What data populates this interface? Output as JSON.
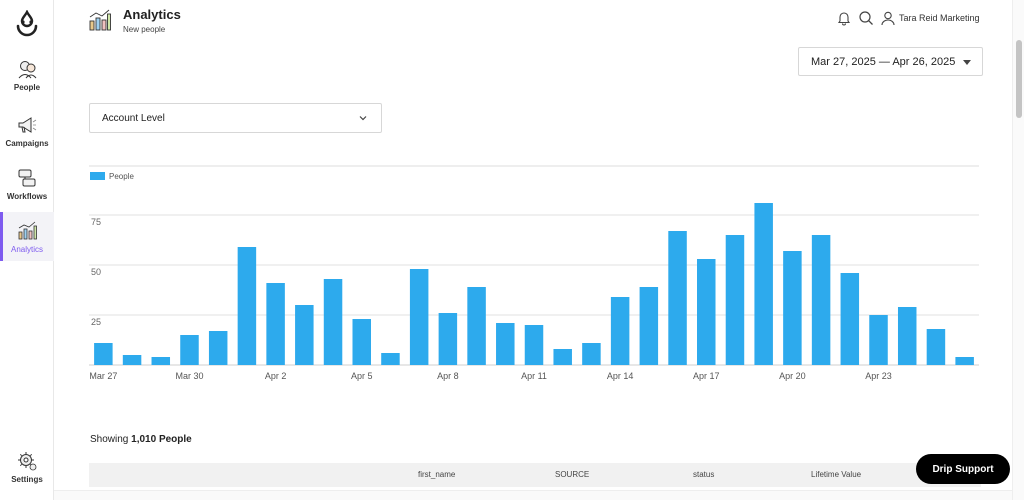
{
  "sidebar": {
    "items": [
      {
        "label": "People",
        "icon": "people-icon"
      },
      {
        "label": "Campaigns",
        "icon": "megaphone-icon"
      },
      {
        "label": "Workflows",
        "icon": "workflow-icon"
      },
      {
        "label": "Analytics",
        "icon": "analytics-icon"
      },
      {
        "label": "Settings",
        "icon": "gear-icon"
      }
    ]
  },
  "header": {
    "title": "Analytics",
    "subtitle": "New people",
    "account": "Tara Reid Marketing"
  },
  "filters": {
    "date_range": "Mar 27, 2025 — Apr 26, 2025",
    "level": "Account Level"
  },
  "colors": {
    "accent": "#7e5bef",
    "bar": "#2daaed",
    "support_bg": "#000000"
  },
  "chart_data": {
    "type": "bar",
    "legend": [
      "People"
    ],
    "categories": [
      "Mar 27",
      "Mar 28",
      "Mar 29",
      "Mar 30",
      "Mar 31",
      "Apr 1",
      "Apr 2",
      "Apr 3",
      "Apr 4",
      "Apr 5",
      "Apr 6",
      "Apr 7",
      "Apr 8",
      "Apr 9",
      "Apr 10",
      "Apr 11",
      "Apr 12",
      "Apr 13",
      "Apr 14",
      "Apr 15",
      "Apr 16",
      "Apr 17",
      "Apr 18",
      "Apr 19",
      "Apr 20",
      "Apr 21",
      "Apr 22",
      "Apr 23",
      "Apr 24",
      "Apr 25",
      "Apr 26"
    ],
    "tick_labels": [
      {
        "index": 0,
        "label": "Mar 27"
      },
      {
        "index": 3,
        "label": "Mar 30"
      },
      {
        "index": 6,
        "label": "Apr 2"
      },
      {
        "index": 9,
        "label": "Apr 5"
      },
      {
        "index": 12,
        "label": "Apr 8"
      },
      {
        "index": 15,
        "label": "Apr 11"
      },
      {
        "index": 18,
        "label": "Apr 14"
      },
      {
        "index": 21,
        "label": "Apr 17"
      },
      {
        "index": 24,
        "label": "Apr 20"
      },
      {
        "index": 27,
        "label": "Apr 23"
      }
    ],
    "series": [
      {
        "name": "People",
        "values": [
          11,
          5,
          4,
          15,
          17,
          59,
          41,
          30,
          43,
          23,
          6,
          48,
          26,
          39,
          21,
          20,
          8,
          11,
          34,
          39,
          67,
          53,
          65,
          81,
          57,
          65,
          46,
          25,
          29,
          18,
          4
        ]
      }
    ],
    "ylim": [
      0,
      100
    ],
    "yticks": [
      25,
      50,
      75
    ],
    "grid": true,
    "legend_position": "top-left"
  },
  "table": {
    "showing_prefix": "Showing ",
    "showing_count": "1,010 People",
    "columns": [
      "first_name",
      "SOURCE",
      "status",
      "Lifetime Value"
    ]
  },
  "support": {
    "label": "Drip Support"
  }
}
